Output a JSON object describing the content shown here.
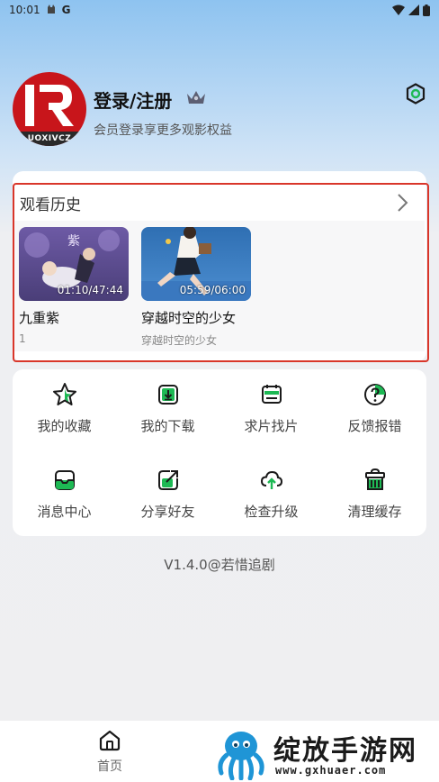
{
  "status_bar": {
    "time": "10:01",
    "g_badge": "G"
  },
  "profile": {
    "title": "登录/注册",
    "subtitle": "会员登录享更多观影权益",
    "avatar_band_text": "UOXIVCZ",
    "vip_icon": "crown-icon",
    "settings_icon": "settings-icon"
  },
  "history": {
    "title": "观看历史",
    "more_icon": "chevron-right-icon",
    "items": [
      {
        "time": "01:10/47:44",
        "title": "九重紫",
        "subtitle": "1"
      },
      {
        "time": "05:59/06:00",
        "title": "穿越时空的少女",
        "subtitle": "穿越时空的少女"
      }
    ]
  },
  "menu": [
    {
      "label": "我的收藏",
      "icon": "star-icon"
    },
    {
      "label": "我的下载",
      "icon": "download-icon"
    },
    {
      "label": "求片找片",
      "icon": "film-request-icon"
    },
    {
      "label": "反馈报错",
      "icon": "feedback-icon"
    },
    {
      "label": "消息中心",
      "icon": "message-icon"
    },
    {
      "label": "分享好友",
      "icon": "share-icon"
    },
    {
      "label": "检查升级",
      "icon": "upgrade-icon"
    },
    {
      "label": "清理缓存",
      "icon": "clear-cache-icon"
    }
  ],
  "version": "V1.4.0@若惜追剧",
  "bottom_nav": {
    "home_label": "首页"
  },
  "watermark": {
    "text": "绽放手游网",
    "url": "www.gxhuaer.com"
  },
  "colors": {
    "accent_green": "#1db954",
    "highlight_red": "#d9362a",
    "avatar_red": "#c8151b"
  }
}
